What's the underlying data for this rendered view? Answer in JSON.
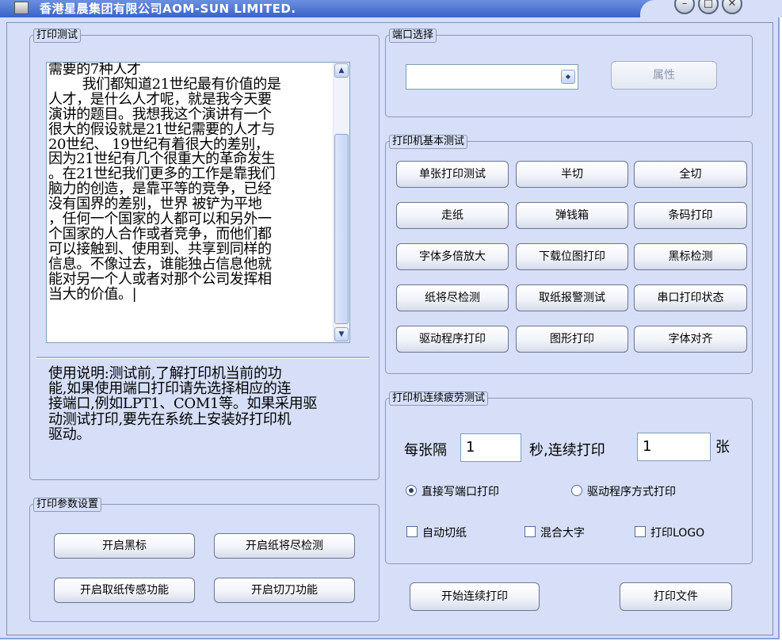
{
  "window": {
    "title": "香港星晨集团有限公司AOM-SUN LIMITED.",
    "caption_buttons": [
      "minimize",
      "maximize",
      "close"
    ]
  },
  "print_test": {
    "label": "打印测试",
    "text_lines": [
      "需要的7种人才",
      "        我们都知道21世纪最有价值的是",
      "人才，是什么人才呢，就是我今天要",
      "演讲的题目。我想我这个演讲有一个",
      "很大的假设就是21世纪需要的人才与",
      "20世纪、 19世纪有着很大的差别，",
      "因为21世纪有几个很重大的革命发生",
      "。在21世纪我们更多的工作是靠我们",
      "脑力的创造，是靠平等的竞争，已经",
      "没有国界的差别，世界 被铲为平地",
      "，任何一个国家的人都可以和另外一",
      "个国家的人合作或者竞争，而他们都",
      "可以接触到、使用到、共享到同样的",
      "信息。不像过去，谁能独占信息他就",
      "能对另一个人或者对那个公司发挥相",
      "当大的价值。|"
    ],
    "usage_lines": [
      "使用说明:测试前,了解打印机当前的功",
      "能,如果使用端口打印请先选择相应的连",
      "接端口,例如LPT1、COM1等。如果采用驱",
      "动测试打印,要先在系统上安装好打印机",
      "驱动。"
    ]
  },
  "print_params": {
    "label": "打印参数设置",
    "buttons": [
      "开启黑标",
      "开启纸将尽检测",
      "开启取纸传感功能",
      "开启切刀功能"
    ]
  },
  "port_select": {
    "label": "端口选择",
    "combo_value": "",
    "properties_button": "属性"
  },
  "basic_test": {
    "label": "打印机基本测试",
    "buttons": [
      "单张打印测试",
      "半切",
      "全切",
      "走纸",
      "弹钱箱",
      "条码打印",
      "字体多倍放大",
      "下载位图打印",
      "黑标检测",
      "纸将尽检测",
      "取纸报警测试",
      "串口打印状态",
      "驱动程序打印",
      "图形打印",
      "字体对齐"
    ]
  },
  "fatigue_test": {
    "label": "打印机连续疲劳测试",
    "interval_label": "每张隔",
    "interval_value": "1",
    "seconds_label": "秒,连续打印",
    "count_value": "1",
    "count_unit": "张",
    "radio_direct": "直接写端口打印",
    "radio_driver": "驱动程序方式打印",
    "radio_selected": "direct",
    "check_autocut": "自动切纸",
    "check_mixed": "混合大字",
    "check_logo": "打印LOGO"
  },
  "bottom_buttons": {
    "start_continuous": "开始连续打印",
    "print_file": "打印文件"
  }
}
